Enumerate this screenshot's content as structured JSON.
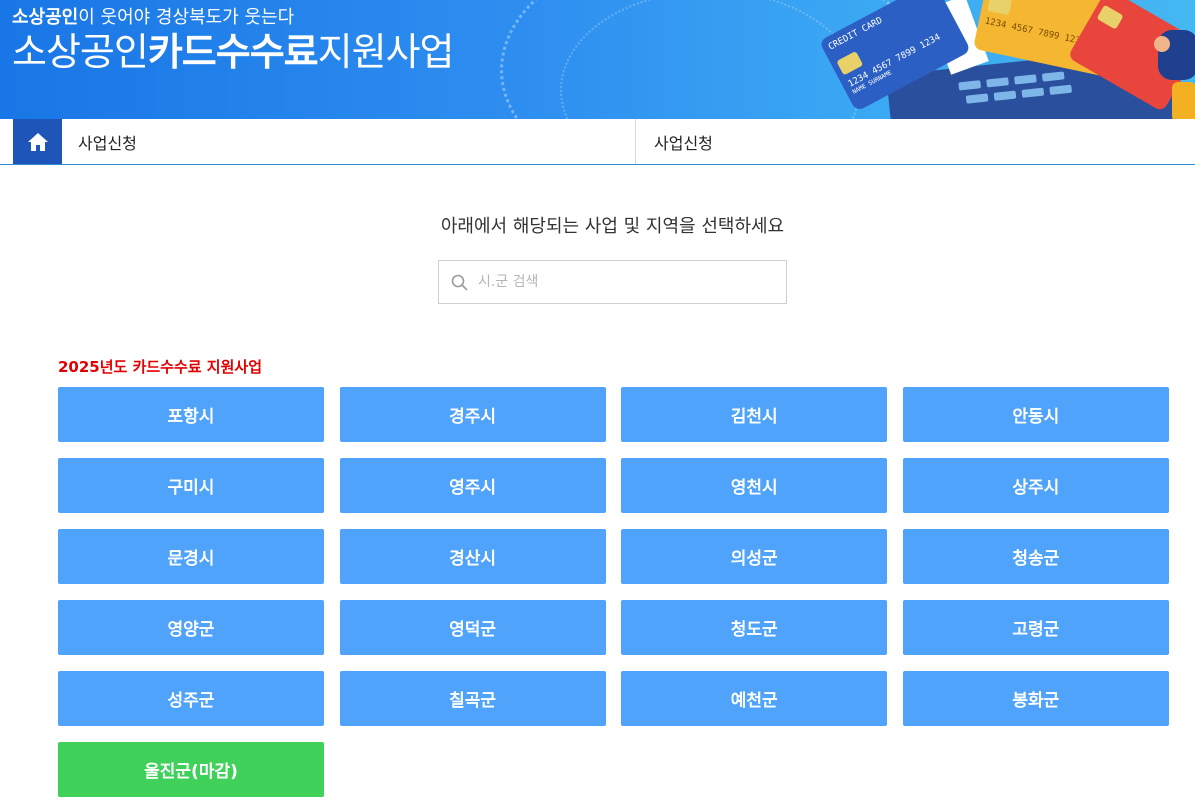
{
  "banner": {
    "slogan_bold": "소상공인",
    "slogan_rest": "이 웃어야 경상북도가 웃는다",
    "headline_pre": "소상공인",
    "headline_bold": "카드수수료",
    "headline_post": "지원사업",
    "card_label": "CREDIT CARD",
    "card_number": "1234 4567 7899 1234",
    "card_name": "NAME SURNAME"
  },
  "nav": {
    "home_icon": "home-icon",
    "item1": "사업신청",
    "item2": "사업신청"
  },
  "main": {
    "instruction": "아래에서 해당되는 사업 및 지역을 선택하세요",
    "search_placeholder": "시.군 검색",
    "section_title": "2025년도 카드수수료 지원사업",
    "regions": [
      "포항시",
      "경주시",
      "김천시",
      "안동시",
      "구미시",
      "영주시",
      "영천시",
      "상주시",
      "문경시",
      "경산시",
      "의성군",
      "청송군",
      "영양군",
      "영덕군",
      "청도군",
      "고령군",
      "성주군",
      "칠곡군",
      "예천군",
      "봉화군",
      "울진군(마감)"
    ]
  },
  "colors": {
    "banner_blue": "#1976e6",
    "home_button": "#1e55b8",
    "region_button": "#4fa3fb",
    "closed_button": "#3fd15a",
    "section_title": "#e30000"
  }
}
